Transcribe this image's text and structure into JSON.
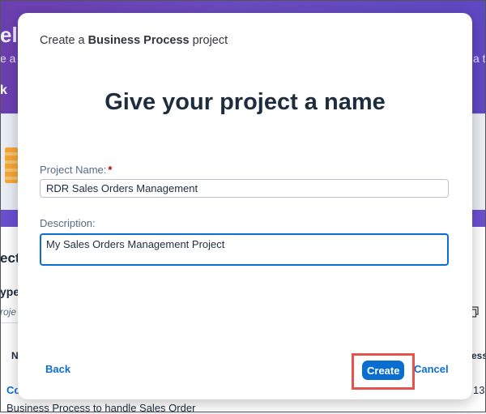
{
  "background": {
    "fragment_top": "el",
    "fragment_banner_left": "e a",
    "fragment_banner_right": "a to",
    "fragment_back": "k",
    "fragment_section": "ect",
    "fragment_type": "ype",
    "fragment_placeholder": "roje",
    "fragment_col_left": "N",
    "fragment_col_right": "ess",
    "fragment_row_link": "Co",
    "fragment_row_num": "13",
    "fragment_row_desc": "Business Process to handle Sales Order",
    "copy_icon": "copy-icon"
  },
  "dialog": {
    "header_prefix": "Create a ",
    "header_bold": "Business Process",
    "header_suffix": " project",
    "title": "Give your project a name",
    "name_label": "Project Name:",
    "name_required_mark": "*",
    "name_value": "RDR Sales Orders Management",
    "description_label": "Description:",
    "description_value": "My Sales Orders Management Project",
    "back_label": "Back",
    "create_label": "Create",
    "cancel_label": "Cancel"
  },
  "colors": {
    "brand_blue": "#0a6ed1",
    "banner_purple": "#6b4fd0",
    "highlight_red": "#e5534b",
    "title_text": "#1d2d3e"
  }
}
